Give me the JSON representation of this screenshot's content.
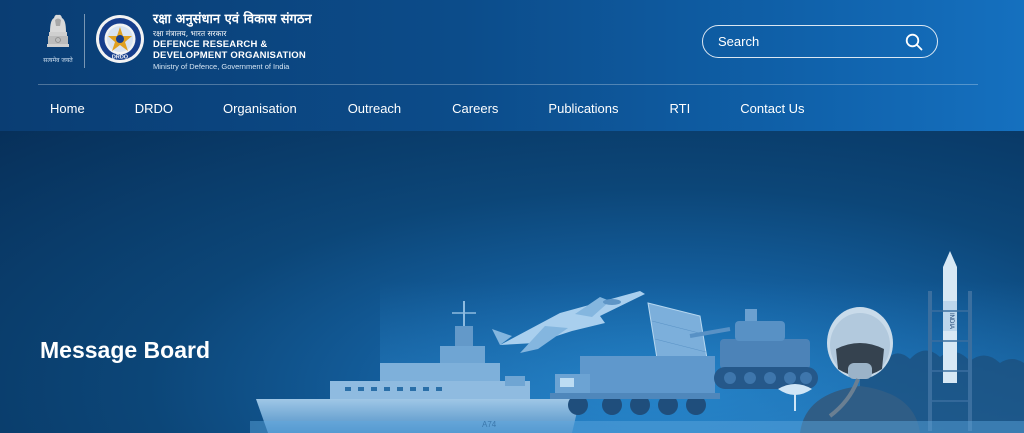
{
  "header": {
    "emblem_motto": "सत्यमेव जयते",
    "seal_label": "DRDO",
    "org_name_hindi": "रक्षा अनुसंधान एवं विकास संगठन",
    "ministry_hindi": "रक्षा मंत्रालय, भारत सरकार",
    "org_name_line1": "DEFENCE RESEARCH &",
    "org_name_line2": "DEVELOPMENT ORGANISATION",
    "ministry_english": "Ministry of Defence, Government of India",
    "search": {
      "placeholder": "Search",
      "icon": "search-icon"
    }
  },
  "nav": {
    "items": [
      {
        "label": "Home"
      },
      {
        "label": "DRDO"
      },
      {
        "label": "Organisation"
      },
      {
        "label": "Outreach"
      },
      {
        "label": "Careers"
      },
      {
        "label": "Publications"
      },
      {
        "label": "RTI"
      },
      {
        "label": "Contact Us"
      }
    ]
  },
  "hero": {
    "title": "Message Board",
    "ship_hull_number": "A74",
    "missile_text": "INDIA"
  },
  "colors": {
    "header_start": "#0a3d73",
    "header_end": "#1570bf",
    "hero_dark": "#07305a",
    "hero_light": "#1e7bc0",
    "text": "#ffffff"
  }
}
